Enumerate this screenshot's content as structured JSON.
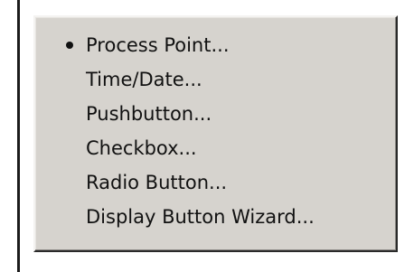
{
  "menu": {
    "items": [
      {
        "label": "Process Point...",
        "selected": true
      },
      {
        "label": "Time/Date...",
        "selected": false
      },
      {
        "label": "Pushbutton...",
        "selected": false
      },
      {
        "label": "Checkbox...",
        "selected": false
      },
      {
        "label": "Radio Button...",
        "selected": false
      },
      {
        "label": "Display Button Wizard...",
        "selected": false
      }
    ]
  },
  "colors": {
    "menu_background": "#d6d3ce",
    "text": "#111111"
  },
  "icons": {
    "selected_marker": "bullet-icon"
  }
}
